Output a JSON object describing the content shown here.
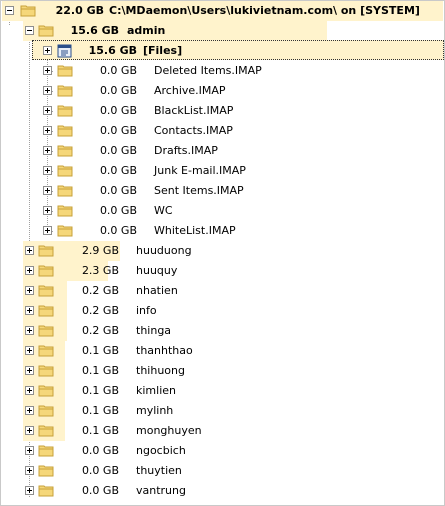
{
  "root": {
    "size": "22.0 GB",
    "name": "C:\\MDaemon\\Users\\lukivietnam.com\\ on [SYSTEM]",
    "fill": 1.0
  },
  "admin": {
    "size": "15.6 GB",
    "name": "admin",
    "fill": 0.709
  },
  "files": {
    "size": "15.6 GB",
    "name": "[Files]",
    "fill": 0.709
  },
  "admin_children": [
    {
      "size": "0.0 GB",
      "name": "Deleted Items.IMAP"
    },
    {
      "size": "0.0 GB",
      "name": "Archive.IMAP"
    },
    {
      "size": "0.0 GB",
      "name": "BlackList.IMAP"
    },
    {
      "size": "0.0 GB",
      "name": "Contacts.IMAP"
    },
    {
      "size": "0.0 GB",
      "name": "Drafts.IMAP"
    },
    {
      "size": "0.0 GB",
      "name": "Junk E-mail.IMAP"
    },
    {
      "size": "0.0 GB",
      "name": "Sent Items.IMAP"
    },
    {
      "size": "0.0 GB",
      "name": "WC"
    },
    {
      "size": "0.0 GB",
      "name": "WhiteList.IMAP"
    }
  ],
  "users": [
    {
      "size": "2.9 GB",
      "name": "huuduong",
      "fill": 0.132
    },
    {
      "size": "2.3 GB",
      "name": "huuquy",
      "fill": 0.105
    },
    {
      "size": "0.2 GB",
      "name": "nhatien",
      "fill": 0.01
    },
    {
      "size": "0.2 GB",
      "name": "info",
      "fill": 0.01
    },
    {
      "size": "0.2 GB",
      "name": "thinga",
      "fill": 0.01
    },
    {
      "size": "0.1 GB",
      "name": "thanhthao",
      "fill": 0.005
    },
    {
      "size": "0.1 GB",
      "name": "thihuong",
      "fill": 0.005
    },
    {
      "size": "0.1 GB",
      "name": "kimlien",
      "fill": 0.005
    },
    {
      "size": "0.1 GB",
      "name": "mylinh",
      "fill": 0.005
    },
    {
      "size": "0.1 GB",
      "name": "monghuyen",
      "fill": 0.005
    },
    {
      "size": "0.0 GB",
      "name": "ngocbich",
      "fill": 0.0
    },
    {
      "size": "0.0 GB",
      "name": "thuytien",
      "fill": 0.0
    },
    {
      "size": "0.0 GB",
      "name": "vantrung",
      "fill": 0.0
    }
  ],
  "colors": {
    "bar": "#fff3cc",
    "folder": "#f5d77a",
    "folder_edge": "#c7a13a"
  },
  "icons": {
    "folder": "folder-icon",
    "files": "file-stack-icon",
    "expand": "expand-icon",
    "collapse": "collapse-icon"
  }
}
